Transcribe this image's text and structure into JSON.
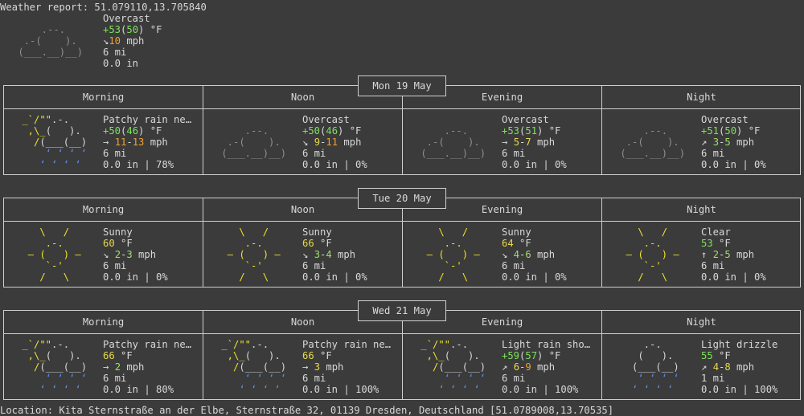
{
  "header": {
    "title": "Weather report: 51.079110,13.705840",
    "condition": "Overcast",
    "temp_main": "+53",
    "temp_feel": "50",
    "temp_unit": " °F",
    "wind_arrow": "↘",
    "wind_speed": "10",
    "wind_unit": " mph",
    "visibility": "6 mi",
    "precip": "0.0 in",
    "art": [
      "     .--.    ",
      "  .-(    ).  ",
      " (___.__)__) "
    ]
  },
  "days": [
    {
      "date": "Mon 19 May",
      "periods": [
        {
          "label": "Morning",
          "condition": "Patchy rain ne…",
          "temp_main": "+50",
          "temp_feel": "46",
          "wind_arrow": "→",
          "wind_lo": "11",
          "wind_hi": "13",
          "visibility": "6 mi",
          "precip": "0.0 in | 78%",
          "icon": "rain-cloud-icon"
        },
        {
          "label": "Noon",
          "condition": "Overcast",
          "temp_main": "+50",
          "temp_feel": "46",
          "wind_arrow": "↘",
          "wind_lo": "9",
          "wind_hi": "11",
          "visibility": "6 mi",
          "precip": "0.0 in | 0%",
          "icon": "overcast-cloud-icon"
        },
        {
          "label": "Evening",
          "condition": "Overcast",
          "temp_main": "+53",
          "temp_feel": "51",
          "wind_arrow": "→",
          "wind_lo": "5",
          "wind_hi": "7",
          "visibility": "6 mi",
          "precip": "0.0 in | 0%",
          "icon": "overcast-cloud-icon"
        },
        {
          "label": "Night",
          "condition": "Overcast",
          "temp_main": "+51",
          "temp_feel": "50",
          "wind_arrow": "↗",
          "wind_lo": "3",
          "wind_hi": "5",
          "visibility": "6 mi",
          "precip": "0.0 in | 0%",
          "icon": "overcast-cloud-icon"
        }
      ]
    },
    {
      "date": "Tue 20 May",
      "periods": [
        {
          "label": "Morning",
          "condition": "Sunny",
          "temp_main": "60",
          "temp_feel": "",
          "wind_arrow": "↘",
          "wind_lo": "2",
          "wind_hi": "3",
          "visibility": "6 mi",
          "precip": "0.0 in | 0%",
          "icon": "sun-icon"
        },
        {
          "label": "Noon",
          "condition": "Sunny",
          "temp_main": "66",
          "temp_feel": "",
          "wind_arrow": "↘",
          "wind_lo": "3",
          "wind_hi": "4",
          "visibility": "6 mi",
          "precip": "0.0 in | 0%",
          "icon": "sun-icon"
        },
        {
          "label": "Evening",
          "condition": "Sunny",
          "temp_main": "64",
          "temp_feel": "",
          "wind_arrow": "↘",
          "wind_lo": "4",
          "wind_hi": "6",
          "visibility": "6 mi",
          "precip": "0.0 in | 0%",
          "icon": "sun-icon"
        },
        {
          "label": "Night",
          "condition": "Clear",
          "temp_main": "53",
          "temp_feel": "",
          "wind_arrow": "↑",
          "wind_lo": "2",
          "wind_hi": "5",
          "visibility": "6 mi",
          "precip": "0.0 in | 0%",
          "icon": "sun-icon"
        }
      ]
    },
    {
      "date": "Wed 21 May",
      "periods": [
        {
          "label": "Morning",
          "condition": "Patchy rain ne…",
          "temp_main": "66",
          "temp_feel": "",
          "wind_arrow": "→",
          "wind_lo": "2",
          "wind_hi": "",
          "visibility": "6 mi",
          "precip": "0.0 in | 80%",
          "icon": "rain-cloud-icon"
        },
        {
          "label": "Noon",
          "condition": "Patchy rain ne…",
          "temp_main": "66",
          "temp_feel": "",
          "wind_arrow": "→",
          "wind_lo": "3",
          "wind_hi": "",
          "visibility": "6 mi",
          "precip": "0.0 in | 100%",
          "icon": "rain-cloud-icon"
        },
        {
          "label": "Evening",
          "condition": "Light rain sho…",
          "temp_main": "+59",
          "temp_feel": "57",
          "wind_arrow": "↗",
          "wind_lo": "6",
          "wind_hi": "9",
          "visibility": "6 mi",
          "precip": "0.0 in | 100%",
          "icon": "rain-cloud-icon"
        },
        {
          "label": "Night",
          "condition": "Light drizzle",
          "temp_main": "55",
          "temp_feel": "",
          "wind_arrow": "↗",
          "wind_lo": "4",
          "wind_hi": "8",
          "visibility": "1 mi",
          "precip": "0.0 in | 100%",
          "icon": "drizzle-cloud-icon"
        }
      ]
    }
  ],
  "footer": {
    "location": "Location: Kita Sternstraße an der Elbe, Sternstraße 32, 01139 Dresden, Deutschland [51.0789008,13.70535]"
  }
}
